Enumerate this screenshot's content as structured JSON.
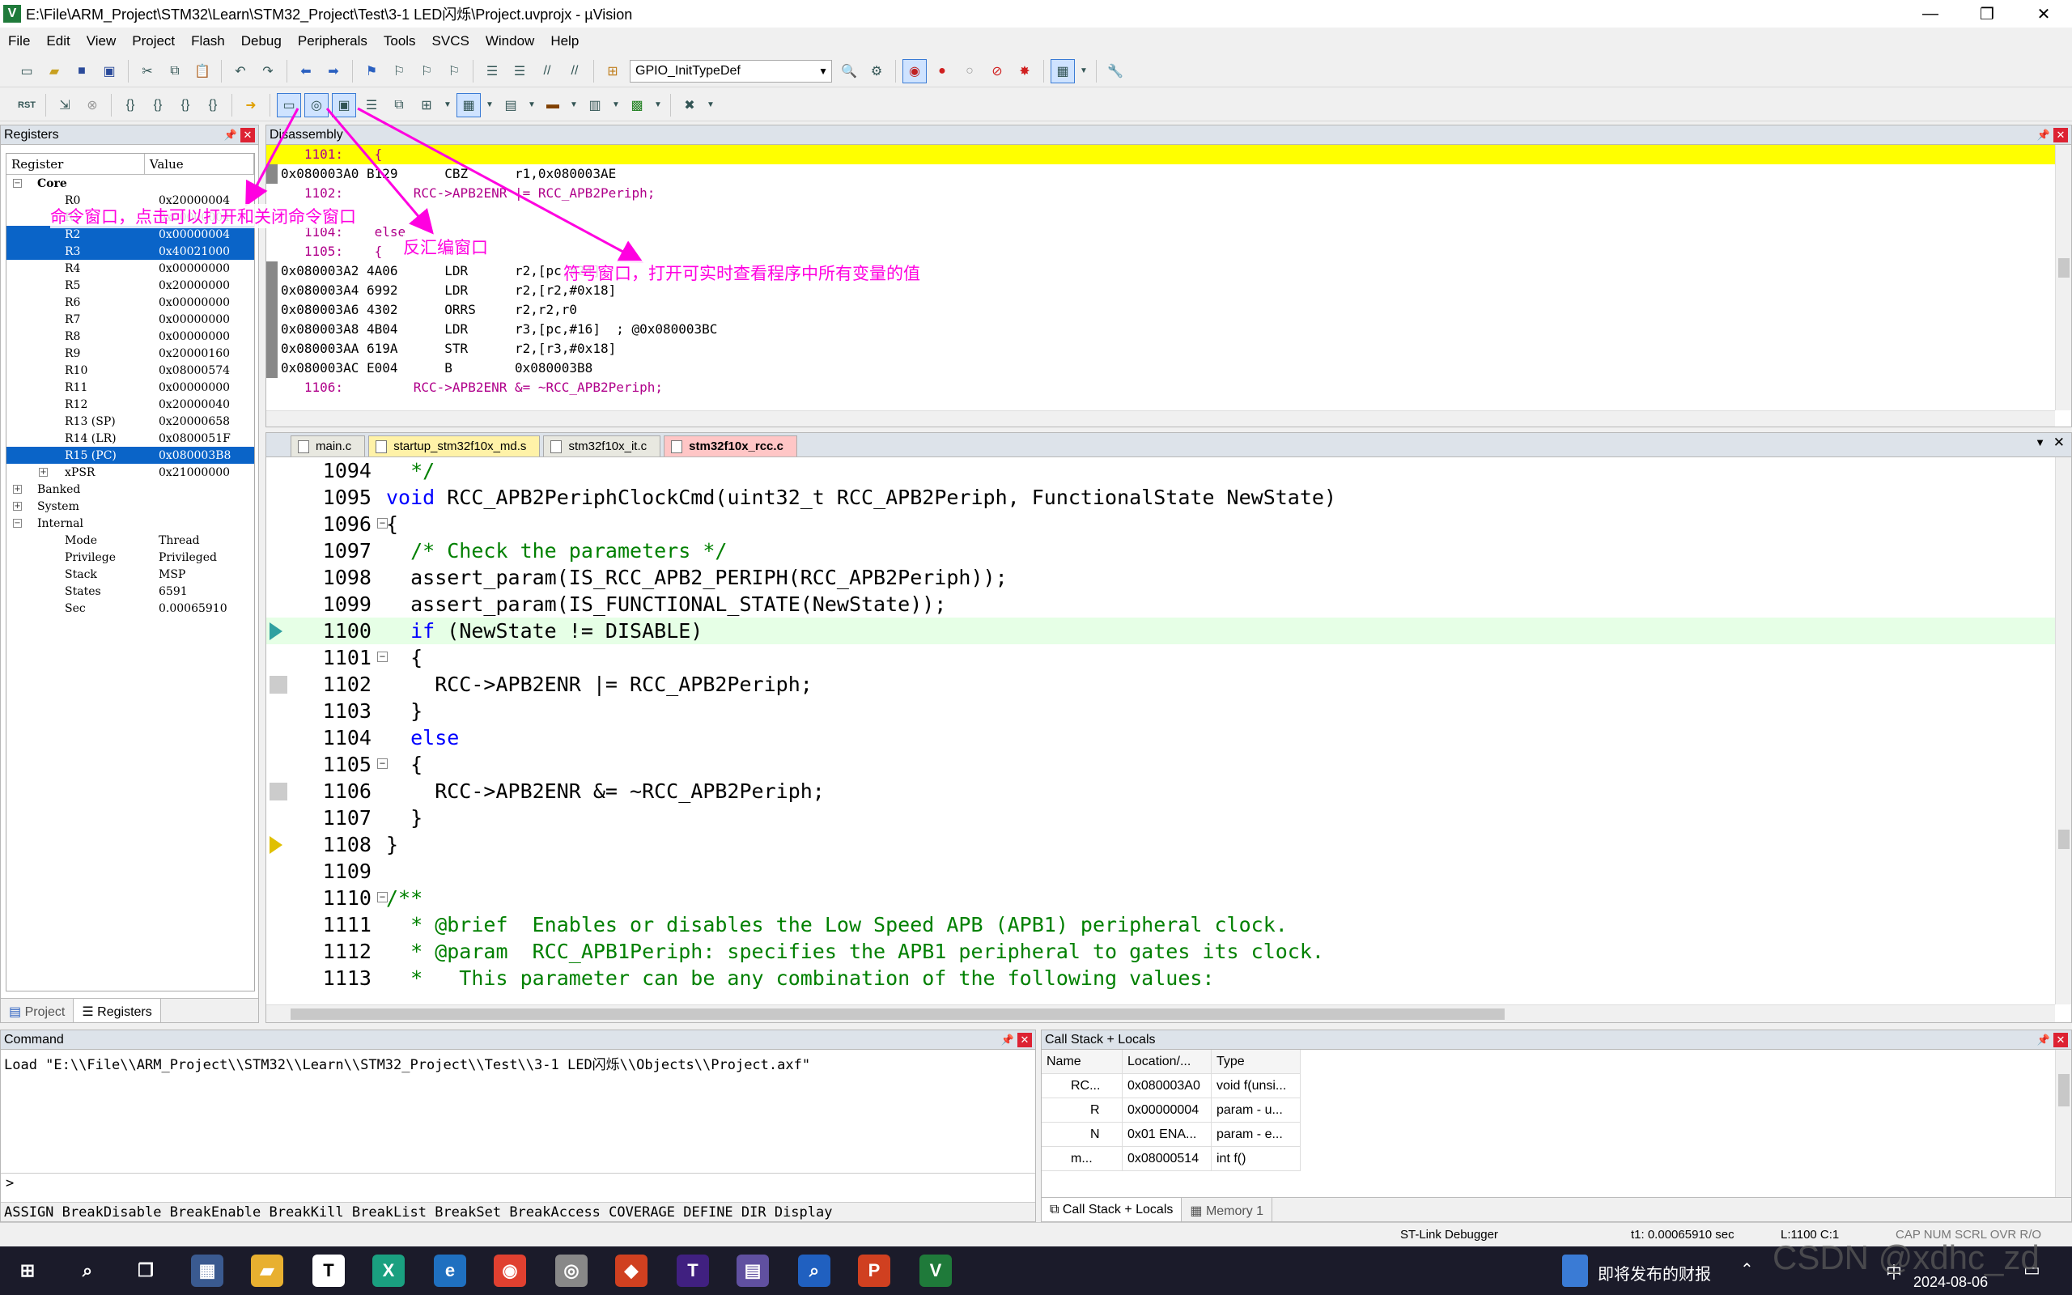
{
  "window": {
    "title": "E:\\File\\ARM_Project\\STM32\\Learn\\STM32_Project\\Test\\3-1 LED闪烁\\Project.uvprojx - µVision",
    "app_icon": "V",
    "minimize": "—",
    "maximize": "❐",
    "close": "✕"
  },
  "menu": [
    "File",
    "Edit",
    "View",
    "Project",
    "Flash",
    "Debug",
    "Peripherals",
    "Tools",
    "SVCS",
    "Window",
    "Help"
  ],
  "toolbar": {
    "combo_value": "GPIO_InitTypeDef"
  },
  "registers": {
    "title": "Registers",
    "col_register": "Register",
    "col_value": "Value",
    "core_label": "Core",
    "rows": [
      {
        "name": "R0",
        "value": "0x20000004"
      },
      {
        "name": "R1",
        "value": "0x00000004"
      },
      {
        "name": "R2",
        "value": "0x00000004"
      },
      {
        "name": "R3",
        "value": "0x40021000"
      },
      {
        "name": "R4",
        "value": "0x00000000"
      },
      {
        "name": "R5",
        "value": "0x20000000"
      },
      {
        "name": "R6",
        "value": "0x00000000"
      },
      {
        "name": "R7",
        "value": "0x00000000"
      },
      {
        "name": "R8",
        "value": "0x00000000"
      },
      {
        "name": "R9",
        "value": "0x20000160"
      },
      {
        "name": "R10",
        "value": "0x08000574"
      },
      {
        "name": "R11",
        "value": "0x00000000"
      },
      {
        "name": "R12",
        "value": "0x20000040"
      },
      {
        "name": "R13 (SP)",
        "value": "0x20000658"
      },
      {
        "name": "R14 (LR)",
        "value": "0x0800051F"
      },
      {
        "name": "R15 (PC)",
        "value": "0x080003B8"
      },
      {
        "name": "xPSR",
        "value": "0x21000000"
      }
    ],
    "groups": [
      "Banked",
      "System",
      "Internal"
    ],
    "internal": [
      {
        "name": "Mode",
        "value": "Thread"
      },
      {
        "name": "Privilege",
        "value": "Privileged"
      },
      {
        "name": "Stack",
        "value": "MSP"
      },
      {
        "name": "States",
        "value": "6591"
      },
      {
        "name": "Sec",
        "value": "0.00065910"
      }
    ],
    "tab_project": "Project",
    "tab_registers": "Registers"
  },
  "disassembly": {
    "title": "Disassembly",
    "lines": [
      {
        "text": "   1101:    {",
        "kind": "src"
      },
      {
        "text": "0x080003A0 B129      CBZ      r1,0x080003AE",
        "kind": "asm"
      },
      {
        "text": "   1102:         RCC->APB2ENR |= RCC_APB2Periph;",
        "kind": "src"
      },
      {
        "text": "",
        "kind": "asm"
      },
      {
        "text": "   1104:    else",
        "kind": "src"
      },
      {
        "text": "   1105:    {",
        "kind": "src"
      },
      {
        "text": "0x080003A2 4A06      LDR      r2,[pc,#24]",
        "kind": "asm"
      },
      {
        "text": "0x080003A4 6992      LDR      r2,[r2,#0x18]",
        "kind": "asm"
      },
      {
        "text": "0x080003A6 4302      ORRS     r2,r2,r0",
        "kind": "asm"
      },
      {
        "text": "0x080003A8 4B04      LDR      r3,[pc,#16]  ; @0x080003BC",
        "kind": "asm"
      },
      {
        "text": "0x080003AA 619A      STR      r2,[r3,#0x18]",
        "kind": "asm"
      },
      {
        "text": "0x080003AC E004      B        0x080003B8",
        "kind": "asm"
      },
      {
        "text": "   1106:         RCC->APB2ENR &= ~RCC_APB2Periph;",
        "kind": "src"
      }
    ]
  },
  "editor": {
    "tabs": [
      "main.c",
      "startup_stm32f10x_md.s",
      "stm32f10x_it.c",
      "stm32f10x_rcc.c"
    ],
    "lines": [
      {
        "n": "1094",
        "t": "  */",
        "c": "cm"
      },
      {
        "n": "1095",
        "t": "void RCC_APB2PeriphClockCmd(uint32_t RCC_APB2Periph, FunctionalState NewState)",
        "c": "fn"
      },
      {
        "n": "1096",
        "t": "{",
        "c": ""
      },
      {
        "n": "1097",
        "t": "  /* Check the parameters */",
        "c": "cm"
      },
      {
        "n": "1098",
        "t": "  assert_param(IS_RCC_APB2_PERIPH(RCC_APB2Periph));",
        "c": ""
      },
      {
        "n": "1099",
        "t": "  assert_param(IS_FUNCTIONAL_STATE(NewState));",
        "c": ""
      },
      {
        "n": "1100",
        "t": "  if (NewState != DISABLE)",
        "c": "if"
      },
      {
        "n": "1101",
        "t": "  {",
        "c": ""
      },
      {
        "n": "1102",
        "t": "    RCC->APB2ENR |= RCC_APB2Periph;",
        "c": ""
      },
      {
        "n": "1103",
        "t": "  }",
        "c": ""
      },
      {
        "n": "1104",
        "t": "  else",
        "c": "kwline"
      },
      {
        "n": "1105",
        "t": "  {",
        "c": ""
      },
      {
        "n": "1106",
        "t": "    RCC->APB2ENR &= ~RCC_APB2Periph;",
        "c": ""
      },
      {
        "n": "1107",
        "t": "  }",
        "c": ""
      },
      {
        "n": "1108",
        "t": "}",
        "c": ""
      },
      {
        "n": "1109",
        "t": "",
        "c": ""
      },
      {
        "n": "1110",
        "t": "/**",
        "c": "cm"
      },
      {
        "n": "1111",
        "t": "  * @brief  Enables or disables the Low Speed APB (APB1) peripheral clock.",
        "c": "cm"
      },
      {
        "n": "1112",
        "t": "  * @param  RCC_APB1Periph: specifies the APB1 peripheral to gates its clock.",
        "c": "cm"
      },
      {
        "n": "1113",
        "t": "  *   This parameter can be any combination of the following values:",
        "c": "cm"
      }
    ]
  },
  "command": {
    "title": "Command",
    "output": "Load \"E:\\\\File\\\\ARM_Project\\\\STM32\\\\Learn\\\\STM32_Project\\\\Test\\\\3-1 LED闪烁\\\\Objects\\\\Project.axf\"",
    "prompt": ">",
    "help": "ASSIGN BreakDisable BreakEnable BreakKill BreakList BreakSet BreakAccess COVERAGE DEFINE DIR Display"
  },
  "callstack": {
    "title": "Call Stack + Locals",
    "col_name": "Name",
    "col_location": "Location/...",
    "col_type": "Type",
    "rows": [
      {
        "name": "RC...",
        "loc": "0x080003A0",
        "type": "void f(unsi..."
      },
      {
        "name": "R",
        "loc": "0x00000004",
        "type": "param - u..."
      },
      {
        "name": "N",
        "loc": "0x01 ENA...",
        "type": "param - e..."
      },
      {
        "name": "m...",
        "loc": "0x08000514",
        "type": "int f()"
      }
    ],
    "tab_callstack": "Call Stack + Locals",
    "tab_memory": "Memory 1"
  },
  "status": {
    "debugger": "ST-Link Debugger",
    "time": "t1: 0.00065910 sec",
    "position": "L:1100 C:1",
    "flags": "CAP  NUM  SCRL  OVR  R/O"
  },
  "taskbar": {
    "news": "即将发布的财报",
    "date": "2024-08-06",
    "ime": "中"
  },
  "annotations": {
    "command_window": "命令窗口，点击可以打开和关闭命令窗口",
    "disasm_window": "反汇编窗口",
    "symbol_window": "符号窗口，打开可实时查看程序中所有变量的值"
  },
  "watermark": "CSDN @xdhc_zd",
  "colors": {
    "annotation": "#ff00e0",
    "highlight_line": "#ffff00",
    "selection": "#0a64c8"
  }
}
